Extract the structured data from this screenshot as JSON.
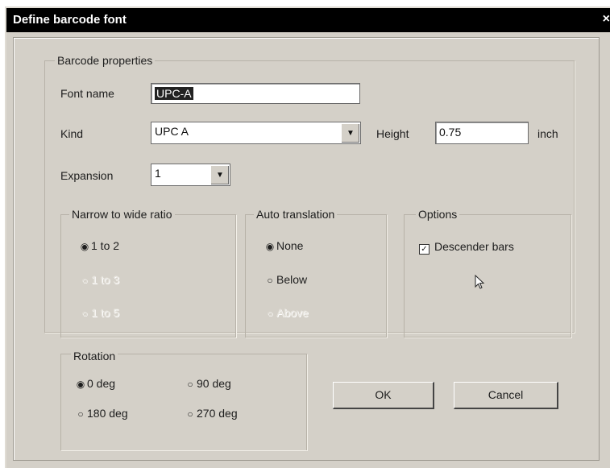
{
  "window": {
    "title": "Define barcode font",
    "close_glyph": "×"
  },
  "barcode_properties": {
    "legend": "Barcode properties",
    "font_name": {
      "label": "Font name",
      "value": "UPC-A"
    },
    "kind": {
      "label": "Kind",
      "value": "UPC A",
      "arrow_glyph": "▼"
    },
    "height": {
      "label": "Height",
      "value": "0.75",
      "unit": "inch"
    },
    "expansion": {
      "label": "Expansion",
      "value": "1",
      "arrow_glyph": "▼"
    }
  },
  "narrow_to_wide": {
    "legend": "Narrow to wide ratio",
    "options": [
      {
        "label": "1 to 2",
        "selected": true,
        "enabled": true
      },
      {
        "label": "1 to 3",
        "selected": false,
        "enabled": false
      },
      {
        "label": "1 to 5",
        "selected": false,
        "enabled": false
      }
    ]
  },
  "auto_translation": {
    "legend": "Auto translation",
    "options": [
      {
        "label": "None",
        "selected": true,
        "enabled": true
      },
      {
        "label": "Below",
        "selected": false,
        "enabled": true
      },
      {
        "label": "Above",
        "selected": false,
        "enabled": false
      }
    ]
  },
  "options": {
    "legend": "Options",
    "descender_bars": {
      "label": "Descender bars",
      "checked": true,
      "check_glyph": "✓"
    }
  },
  "rotation": {
    "legend": "Rotation",
    "options": [
      {
        "label": "0 deg",
        "selected": true
      },
      {
        "label": "90 deg",
        "selected": false
      },
      {
        "label": "180 deg",
        "selected": false
      },
      {
        "label": "270 deg",
        "selected": false
      }
    ]
  },
  "buttons": {
    "ok": "OK",
    "cancel": "Cancel"
  },
  "radio_glyphs": {
    "on": "◉",
    "off": "○"
  }
}
